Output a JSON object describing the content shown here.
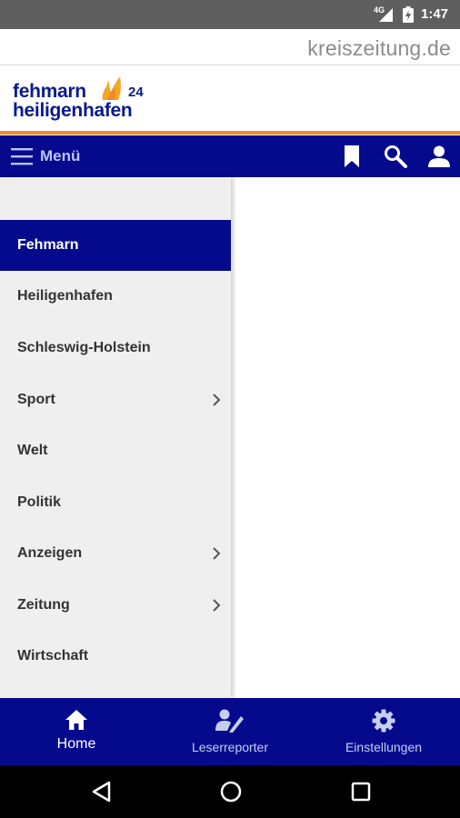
{
  "status_bar": {
    "network": "4G",
    "time": "1:47"
  },
  "publisher": {
    "name": "kreiszeitung.de"
  },
  "brand": {
    "line1": "fehmarn",
    "number": "24",
    "line2": "heiligenhafen",
    "accent_color": "#f08c28",
    "primary_color": "#050a8c"
  },
  "topnav": {
    "menu_label": "Menü"
  },
  "drawer": {
    "items": [
      {
        "label": "Fehmarn",
        "active": true,
        "has_submenu": false
      },
      {
        "label": "Heiligenhafen",
        "active": false,
        "has_submenu": false
      },
      {
        "label": "Schleswig-Holstein",
        "active": false,
        "has_submenu": false
      },
      {
        "label": "Sport",
        "active": false,
        "has_submenu": true
      },
      {
        "label": "Welt",
        "active": false,
        "has_submenu": false
      },
      {
        "label": "Politik",
        "active": false,
        "has_submenu": false
      },
      {
        "label": "Anzeigen",
        "active": false,
        "has_submenu": true
      },
      {
        "label": "Zeitung",
        "active": false,
        "has_submenu": true
      },
      {
        "label": "Wirtschaft",
        "active": false,
        "has_submenu": false
      }
    ]
  },
  "tabbar": {
    "tabs": [
      {
        "label": "Home",
        "icon": "home-icon",
        "active": true
      },
      {
        "label": "Leserreporter",
        "icon": "reporter-icon",
        "active": false
      },
      {
        "label": "Einstellungen",
        "icon": "gear-icon",
        "active": false
      }
    ]
  }
}
